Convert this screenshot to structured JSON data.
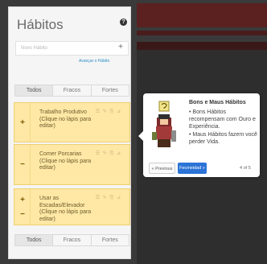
{
  "panel": {
    "title": "Hábitos",
    "help_icon": "?",
    "new_placeholder": "Novo Hábito",
    "add_icon": "+",
    "advanced_link": "Avançar o Hábito",
    "tabs_top": [
      "Todos",
      "Fracos",
      "Fortes"
    ],
    "tabs_bottom": [
      "Todos",
      "Fracos",
      "Fortes"
    ]
  },
  "habits": [
    {
      "plus": "+",
      "minus": "",
      "text": "Trabalho Produtivo (Clique no lápis para editar)",
      "controls": "☰ ✎ ⎘ ⊿"
    },
    {
      "plus": "",
      "minus": "−",
      "text": "Comer Porcarias (Clique no lápis para editar)",
      "controls": "☰ ✎ ⎘ ⊿"
    },
    {
      "plus": "+",
      "minus": "−",
      "text": "Usar as Escadas/Elevador (Clique no lápis para editar)",
      "controls": "☰ ✎ ⎘ ⊿"
    }
  ],
  "popover": {
    "title": "Bons e Maus Hábitos",
    "bullets": [
      "• Bons Hábitos recompensam com Ouro e Experiência.",
      "• Maus Hábitos fazem você perder Vida."
    ],
    "prev_label": "« Previous",
    "next_label": "Fecmeidad »",
    "counter": "4 of 5"
  },
  "colors": {
    "accent": "#2c73d6",
    "habit_bg": "#ffe8a6",
    "link": "#2a8fc6"
  },
  "icons": {
    "help": "question-icon",
    "add": "plus-icon"
  }
}
